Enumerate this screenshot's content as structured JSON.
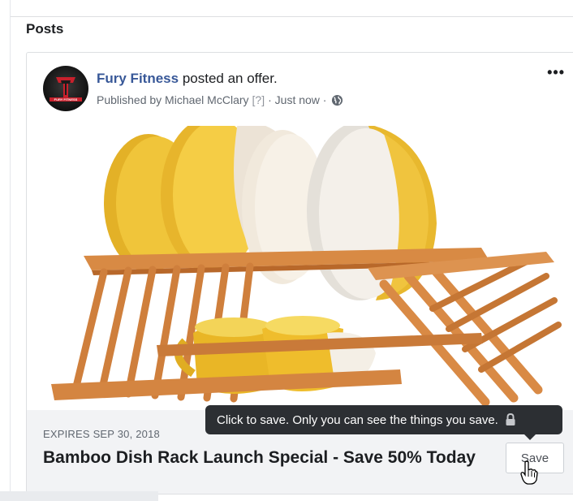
{
  "section": {
    "title": "Posts"
  },
  "post": {
    "page_name": "Fury Fitness",
    "action_text": " posted an offer.",
    "published_by": "Published by Michael McClary",
    "help_mark": "[?]",
    "timestamp": "· Just now ·",
    "privacy_icon": "globe-icon",
    "more_icon": "•••"
  },
  "avatar": {
    "brand_text": "FURY FITNESS"
  },
  "offer": {
    "expires": "EXPIRES SEP 30, 2018",
    "title": "Bamboo Dish Rack Launch Special - Save 50% Today",
    "save_label": "Save"
  },
  "tooltip": {
    "text": "Click to save. Only you can see the things you save.",
    "icon": "lock-icon"
  },
  "colors": {
    "link": "#385898",
    "tooltip_bg": "#2c2f33",
    "offer_bar_bg": "#f2f3f5",
    "plate_yellow": "#e8b92a",
    "bamboo": "#d98a45"
  }
}
